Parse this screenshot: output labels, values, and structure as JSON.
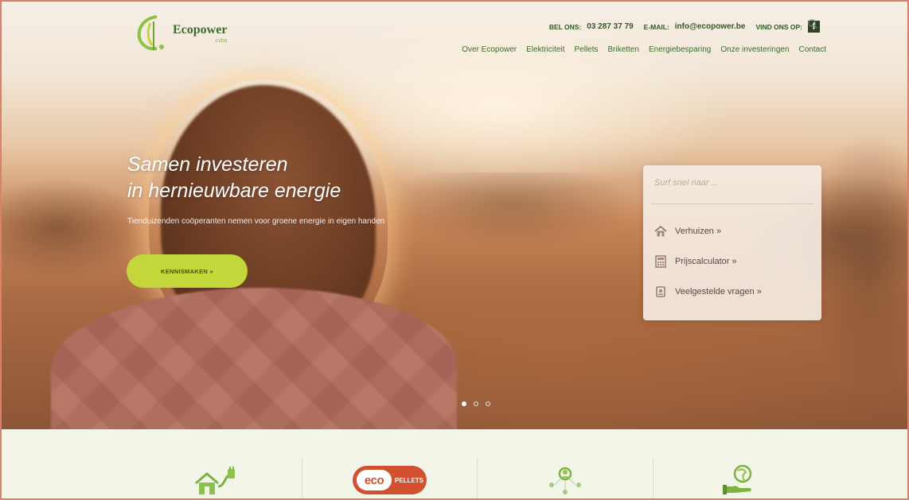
{
  "header": {
    "logo_name": "Ecopower",
    "logo_sub": "cvba",
    "phone_label": "BEL ONS:",
    "phone_value": "03 287 37 79",
    "email_label": "E-MAIL:",
    "email_value": "info@ecopower.be",
    "social_label": "VIND ONS OP:",
    "social_icon": "facebook-icon",
    "search_icon": "search-icon"
  },
  "nav": {
    "items": [
      "Over Ecopower",
      "Elektriciteit",
      "Pellets",
      "Briketten",
      "Energiebesparing",
      "Onze investeringen",
      "Contact"
    ]
  },
  "hero": {
    "headline_line1": "Samen investeren",
    "headline_line2": "in hernieuwbare energie",
    "subtext": "Tienduizenden coöperanten nemen voor groene energie in eigen handen",
    "cta_label": "KENNISMAKEN »",
    "slides": 3,
    "active_slide": 1
  },
  "quicklinks": {
    "search_placeholder": "Surf snel naar ...",
    "items": [
      {
        "label": "Verhuizen »",
        "icon": "house-icon"
      },
      {
        "label": "Prijscalculator »",
        "icon": "calculator-icon"
      },
      {
        "label": "Veelgestelde vragen »",
        "icon": "faq-icon"
      }
    ]
  },
  "strip": {
    "pellets_badge_eco": "eco",
    "pellets_badge_text": "PELLETS",
    "icons": [
      "green-house-plug-icon",
      "eco-pellets-badge",
      "community-people-icon",
      "hand-globe-icon"
    ]
  },
  "colors": {
    "brand_green": "#3b6e2a",
    "cta_lime": "#c3d63a",
    "pellets_red": "#d0502f",
    "strip_bg": "#f4f5e9"
  }
}
